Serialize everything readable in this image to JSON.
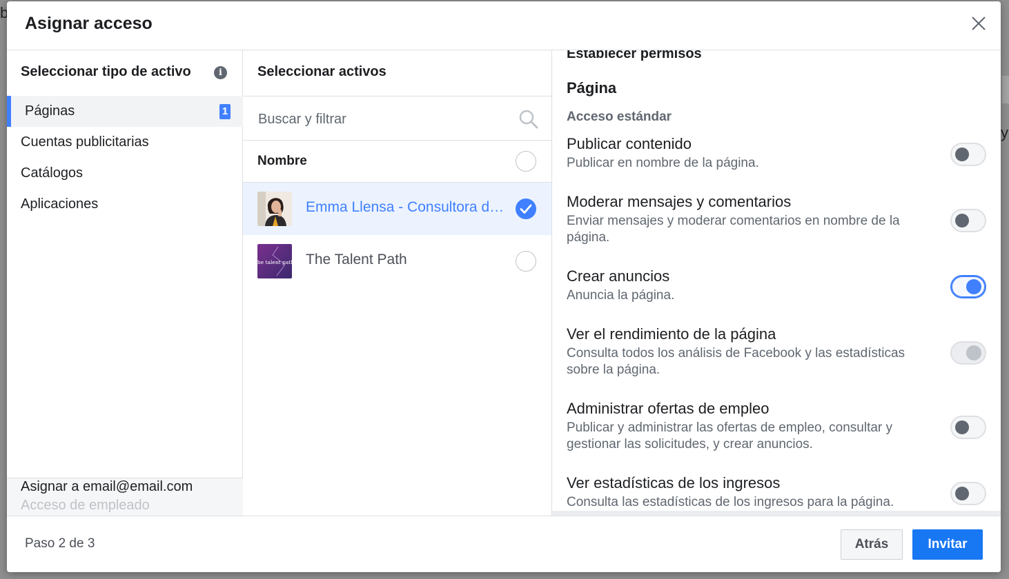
{
  "background": {
    "left_char": "b",
    "right_char": "y"
  },
  "modal": {
    "title": "Asignar acceso"
  },
  "asset_types": {
    "heading": "Seleccionar tipo de activo",
    "info_glyph": "i",
    "items": [
      {
        "label": "Páginas",
        "count": "1",
        "active": true
      },
      {
        "label": "Cuentas publicitarias"
      },
      {
        "label": "Catálogos"
      },
      {
        "label": "Aplicaciones"
      }
    ],
    "assign_to": "Asignar a email@email.com",
    "access_level": "Acceso de empleado"
  },
  "assets": {
    "heading": "Seleccionar activos",
    "search_placeholder": "Buscar y filtrar",
    "column_name": "Nombre",
    "rows": [
      {
        "name": "Emma Llensa - Consultora de Talento",
        "selected": true
      },
      {
        "name": "The Talent Path",
        "selected": false,
        "thumb_text": "the talent path"
      }
    ]
  },
  "permissions": {
    "heading": "Establecer permisos",
    "section": "Página",
    "subsection": "Acceso estándar",
    "items": [
      {
        "name": "Publicar contenido",
        "desc": "Publicar en nombre de la página.",
        "state": "off"
      },
      {
        "name": "Moderar mensajes y comentarios",
        "desc": "Enviar mensajes y moderar comentarios en nombre de la página.",
        "state": "off"
      },
      {
        "name": "Crear anuncios",
        "desc": "Anuncia la página.",
        "state": "on"
      },
      {
        "name": "Ver el rendimiento de la página",
        "desc": "Consulta todos los análisis de Facebook y las estadísticas sobre la página.",
        "state": "disabled"
      },
      {
        "name": "Administrar ofertas de empleo",
        "desc": "Publicar y administrar las ofertas de empleo, consultar y gestionar las solicitudes, y crear anuncios.",
        "state": "off"
      },
      {
        "name": "Ver estadísticas de los ingresos",
        "desc": "Consulta las estadísticas de los ingresos para la página.",
        "state": "off"
      }
    ]
  },
  "footer": {
    "step": "Paso 2 de 3",
    "back_label": "Atrás",
    "invite_label": "Invitar"
  },
  "colors": {
    "accent": "#4080ff",
    "primary_button": "#1877f2",
    "selected_row": "#ecf3ff"
  }
}
